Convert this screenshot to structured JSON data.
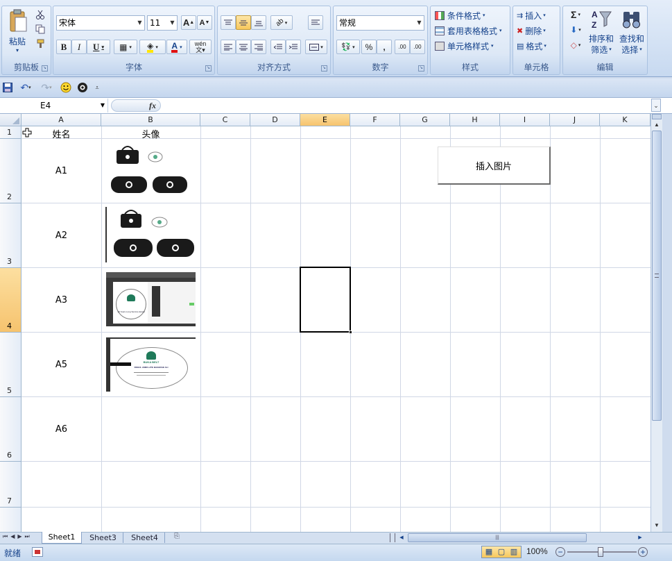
{
  "ribbon": {
    "clipboard": {
      "title": "剪贴板",
      "paste_label": "粘贴"
    },
    "font": {
      "title": "字体",
      "font_name": "宋体",
      "font_size": "11",
      "grow_label": "A",
      "shrink_label": "A",
      "bold": "B",
      "italic": "I",
      "underline": "U",
      "font_color_label": "A",
      "phonetic_label": "wén"
    },
    "alignment": {
      "title": "对齐方式"
    },
    "number": {
      "title": "数字",
      "format": "常规",
      "percent": "%",
      "comma": ",",
      "inc_decimal": ".00",
      "dec_decimal": ".00"
    },
    "styles": {
      "title": "样式",
      "conditional": "条件格式",
      "table_format": "套用表格格式",
      "cell_styles": "单元格样式"
    },
    "cells": {
      "title": "单元格",
      "insert": "插入",
      "delete": "删除",
      "format": "格式"
    },
    "editing": {
      "title": "编辑",
      "sort_line1": "排序和",
      "sort_line2": "筛选",
      "find_line1": "查找和",
      "find_line2": "选择"
    }
  },
  "formula_bar": {
    "name_box": "E4",
    "fx": "fx",
    "content": ""
  },
  "sheet": {
    "columns": [
      "A",
      "B",
      "C",
      "D",
      "E",
      "F",
      "G",
      "H",
      "I",
      "J",
      "K"
    ],
    "rows": [
      "1",
      "2",
      "3",
      "4",
      "5",
      "6",
      "7"
    ],
    "selected_cell": "E4",
    "cells": {
      "A1": "姓名",
      "B1": "头像",
      "A2": "A1",
      "A3": "A2",
      "A4": "A3",
      "A5": "A5",
      "A6": "A6"
    },
    "button_label": "插入图片",
    "image_text": {
      "award_title": "10 Years Long Service Award",
      "award_name": "ROHUL AMIN LATE BAGERAE ALI",
      "logo": "BUKA BELT"
    }
  },
  "sheet_tabs": [
    "Sheet1",
    "Sheet3",
    "Sheet4"
  ],
  "status": {
    "ready": "就绪",
    "zoom": "100%"
  }
}
